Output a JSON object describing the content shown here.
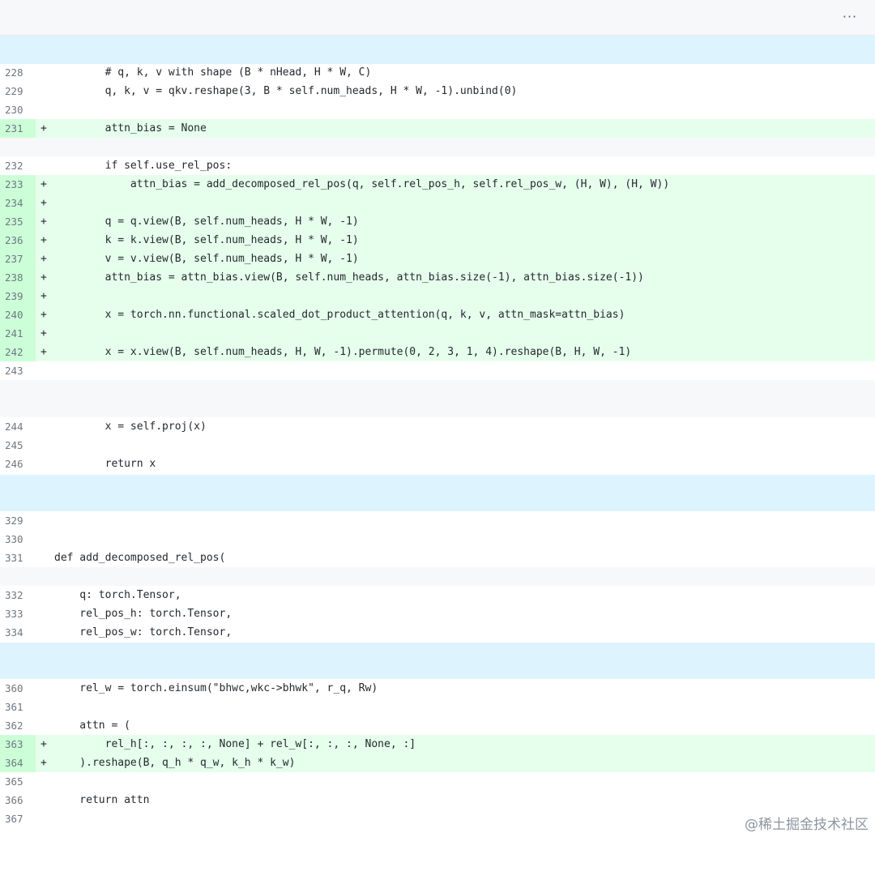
{
  "toolbar": {
    "more_label": "···"
  },
  "watermark": "@稀土掘金技术社区",
  "lines": [
    {
      "num": "228",
      "type": "ctx",
      "code": "        # q, k, v with shape (B * nHead, H * W, C)"
    },
    {
      "num": "229",
      "type": "ctx",
      "code": "        q, k, v = qkv.reshape(3, B * self.num_heads, H * W, -1).unbind(0)"
    },
    {
      "num": "230",
      "type": "ctx",
      "code": ""
    },
    {
      "num": "231",
      "type": "add",
      "code": "        attn_bias = None"
    },
    {
      "num": "232",
      "type": "ctx",
      "code": "        if self.use_rel_pos:"
    },
    {
      "num": "233",
      "type": "add",
      "code": "            attn_bias = add_decomposed_rel_pos(q, self.rel_pos_h, self.rel_pos_w, (H, W), (H, W))"
    },
    {
      "num": "234",
      "type": "add",
      "code": ""
    },
    {
      "num": "235",
      "type": "add",
      "code": "        q = q.view(B, self.num_heads, H * W, -1)"
    },
    {
      "num": "236",
      "type": "add",
      "code": "        k = k.view(B, self.num_heads, H * W, -1)"
    },
    {
      "num": "237",
      "type": "add",
      "code": "        v = v.view(B, self.num_heads, H * W, -1)"
    },
    {
      "num": "238",
      "type": "add",
      "code": "        attn_bias = attn_bias.view(B, self.num_heads, attn_bias.size(-1), attn_bias.size(-1))"
    },
    {
      "num": "239",
      "type": "add",
      "code": ""
    },
    {
      "num": "240",
      "type": "add",
      "code": "        x = torch.nn.functional.scaled_dot_product_attention(q, k, v, attn_mask=attn_bias)"
    },
    {
      "num": "241",
      "type": "add",
      "code": ""
    },
    {
      "num": "242",
      "type": "add",
      "code": "        x = x.view(B, self.num_heads, H, W, -1).permute(0, 2, 3, 1, 4).reshape(B, H, W, -1)"
    },
    {
      "num": "243",
      "type": "ctx",
      "code": ""
    },
    {
      "num": "244",
      "type": "ctx",
      "code": "        x = self.proj(x)"
    },
    {
      "num": "245",
      "type": "ctx",
      "code": ""
    },
    {
      "num": "246",
      "type": "ctx",
      "code": "        return x"
    },
    {
      "num": "329",
      "type": "ctx",
      "code": ""
    },
    {
      "num": "330",
      "type": "ctx",
      "code": ""
    },
    {
      "num": "331",
      "type": "ctx",
      "code": "def add_decomposed_rel_pos("
    },
    {
      "num": "332",
      "type": "ctx",
      "code": "    q: torch.Tensor,"
    },
    {
      "num": "333",
      "type": "ctx",
      "code": "    rel_pos_h: torch.Tensor,"
    },
    {
      "num": "334",
      "type": "ctx",
      "code": "    rel_pos_w: torch.Tensor,"
    },
    {
      "num": "360",
      "type": "ctx",
      "code": "    rel_w = torch.einsum(\"bhwc,wkc->bhwk\", r_q, Rw)"
    },
    {
      "num": "361",
      "type": "ctx",
      "code": ""
    },
    {
      "num": "362",
      "type": "ctx",
      "code": "    attn = ("
    },
    {
      "num": "363",
      "type": "add",
      "code": "        rel_h[:, :, :, :, None] + rel_w[:, :, :, None, :]"
    },
    {
      "num": "364",
      "type": "add",
      "code": "    ).reshape(B, q_h * q_w, k_h * k_w)"
    },
    {
      "num": "365",
      "type": "ctx",
      "code": ""
    },
    {
      "num": "366",
      "type": "ctx",
      "code": "    return attn"
    },
    {
      "num": "367",
      "type": "ctx",
      "code": ""
    }
  ]
}
